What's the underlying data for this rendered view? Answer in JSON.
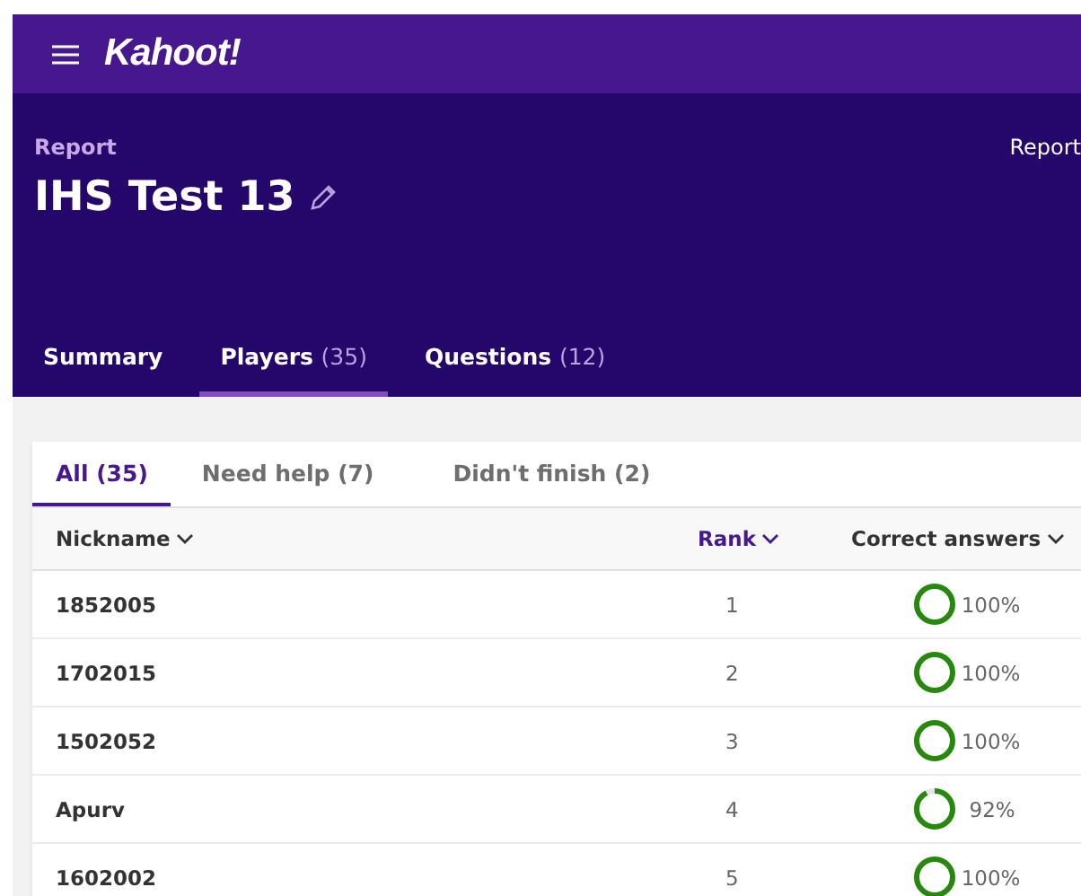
{
  "topbar": {
    "logo": "Kahoot!"
  },
  "header": {
    "label": "Report",
    "title": "IHS Test 13",
    "right_link": "Report"
  },
  "tabs": [
    {
      "label": "Summary",
      "selected": false
    },
    {
      "label": "Players",
      "count": "(35)",
      "selected": true
    },
    {
      "label": "Questions",
      "count": "(12)",
      "selected": false
    }
  ],
  "filters": [
    {
      "label": "All (35)",
      "selected": true
    },
    {
      "label": "Need help (7)",
      "selected": false
    },
    {
      "label": "Didn't finish (2)",
      "selected": false
    }
  ],
  "columns": [
    {
      "label": "Nickname",
      "sorted": false
    },
    {
      "label": "Rank",
      "sorted": true
    },
    {
      "label": "Correct answers",
      "sorted": false
    }
  ],
  "rows": [
    {
      "nickname": "1852005",
      "rank": "1",
      "level": 1,
      "correct": "100%"
    },
    {
      "nickname": "1702015",
      "rank": "2",
      "level": 1,
      "correct": "100%"
    },
    {
      "nickname": "1502052",
      "rank": "3",
      "level": 1,
      "correct": "100%"
    },
    {
      "nickname": "Apurv",
      "rank": "4",
      "level": 0.92,
      "correct": "92%"
    },
    {
      "nickname": "1602002",
      "rank": "5",
      "level": 1,
      "correct": "100%"
    }
  ]
}
